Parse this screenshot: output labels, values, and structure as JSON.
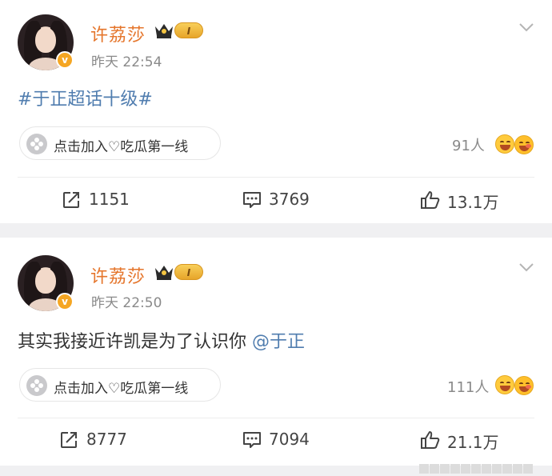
{
  "posts": [
    {
      "username": "许荔莎",
      "level_badge": "I",
      "verified_mark": "v",
      "time": "昨天 22:54",
      "content": {
        "topic": "#于正超话十级#",
        "text": "",
        "mention": ""
      },
      "group_pill": "点击加入♡吃瓜第一线",
      "joined_count": "91人",
      "actions": {
        "repost": "1151",
        "comment": "3769",
        "like": "13.1万"
      }
    },
    {
      "username": "许荔莎",
      "level_badge": "I",
      "verified_mark": "v",
      "time": "昨天 22:50",
      "content": {
        "topic": "",
        "text": "其实我接近许凯是为了认识你 ",
        "mention": "@于正"
      },
      "group_pill": "点击加入♡吃瓜第一线",
      "joined_count": "111人",
      "actions": {
        "repost": "8777",
        "comment": "7094",
        "like": "21.1万"
      }
    }
  ],
  "icons": {
    "crown": "crown-icon",
    "chevron": "chevron-down-icon",
    "pill": "flower-icon",
    "repost": "repost-icon",
    "comment": "comment-icon",
    "like": "thumbs-up-icon",
    "emoji": "laughing-emoji-icon"
  },
  "colors": {
    "username": "#e5762c",
    "link": "#507daf",
    "meta": "#8a8a8a",
    "background": "#f0f0f2"
  }
}
